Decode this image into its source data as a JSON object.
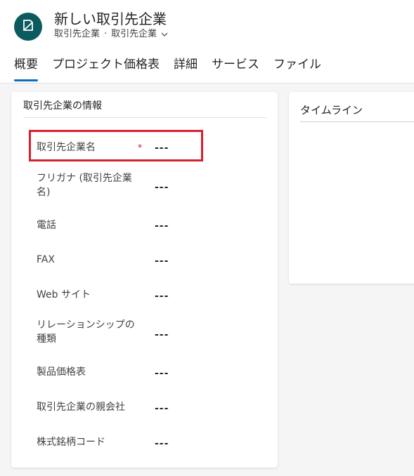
{
  "header": {
    "title": "新しい取引先企業",
    "entity": "取引先企業",
    "separator": "·",
    "form": "取引先企業",
    "avatar_color": "#0b5a5f"
  },
  "tabs": [
    {
      "label": "概要",
      "active": true
    },
    {
      "label": "プロジェクト価格表"
    },
    {
      "label": "詳細"
    },
    {
      "label": "サービス"
    },
    {
      "label": "ファイル"
    }
  ],
  "section": {
    "title": "取引先企業の情報"
  },
  "fields": [
    {
      "label": "取引先企業名",
      "value": "---",
      "required_mark": "*"
    },
    {
      "label": "フリガナ (取引先企業名)",
      "value": "---"
    },
    {
      "label": "電話",
      "value": "---"
    },
    {
      "label": "FAX",
      "value": "---"
    },
    {
      "label": "Web サイト",
      "value": "---"
    },
    {
      "label": "リレーションシップの種類",
      "value": "---"
    },
    {
      "label": "製品価格表",
      "value": "---"
    },
    {
      "label": "取引先企業の親会社",
      "value": "---"
    },
    {
      "label": "株式銘柄コード",
      "value": "---"
    }
  ],
  "timeline": {
    "title": "タイムライン"
  },
  "colors": {
    "accent": "#0f6cbd",
    "highlight": "#d9202f",
    "required": "#c50f1f"
  }
}
